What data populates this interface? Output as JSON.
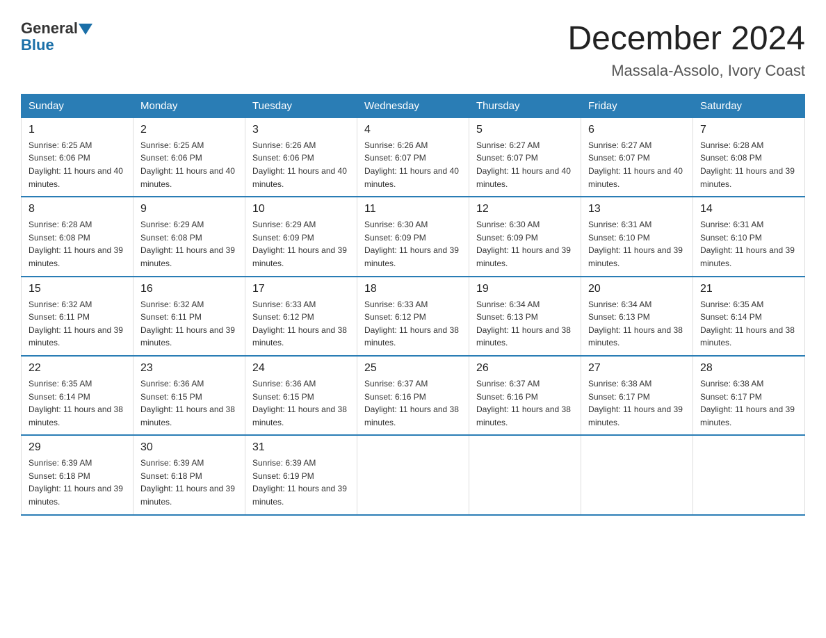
{
  "header": {
    "logo_general": "General",
    "logo_blue": "Blue",
    "month_title": "December 2024",
    "location": "Massala-Assolo, Ivory Coast"
  },
  "columns": [
    "Sunday",
    "Monday",
    "Tuesday",
    "Wednesday",
    "Thursday",
    "Friday",
    "Saturday"
  ],
  "weeks": [
    [
      {
        "day": "1",
        "sunrise": "6:25 AM",
        "sunset": "6:06 PM",
        "daylight": "11 hours and 40 minutes."
      },
      {
        "day": "2",
        "sunrise": "6:25 AM",
        "sunset": "6:06 PM",
        "daylight": "11 hours and 40 minutes."
      },
      {
        "day": "3",
        "sunrise": "6:26 AM",
        "sunset": "6:06 PM",
        "daylight": "11 hours and 40 minutes."
      },
      {
        "day": "4",
        "sunrise": "6:26 AM",
        "sunset": "6:07 PM",
        "daylight": "11 hours and 40 minutes."
      },
      {
        "day": "5",
        "sunrise": "6:27 AM",
        "sunset": "6:07 PM",
        "daylight": "11 hours and 40 minutes."
      },
      {
        "day": "6",
        "sunrise": "6:27 AM",
        "sunset": "6:07 PM",
        "daylight": "11 hours and 40 minutes."
      },
      {
        "day": "7",
        "sunrise": "6:28 AM",
        "sunset": "6:08 PM",
        "daylight": "11 hours and 39 minutes."
      }
    ],
    [
      {
        "day": "8",
        "sunrise": "6:28 AM",
        "sunset": "6:08 PM",
        "daylight": "11 hours and 39 minutes."
      },
      {
        "day": "9",
        "sunrise": "6:29 AM",
        "sunset": "6:08 PM",
        "daylight": "11 hours and 39 minutes."
      },
      {
        "day": "10",
        "sunrise": "6:29 AM",
        "sunset": "6:09 PM",
        "daylight": "11 hours and 39 minutes."
      },
      {
        "day": "11",
        "sunrise": "6:30 AM",
        "sunset": "6:09 PM",
        "daylight": "11 hours and 39 minutes."
      },
      {
        "day": "12",
        "sunrise": "6:30 AM",
        "sunset": "6:09 PM",
        "daylight": "11 hours and 39 minutes."
      },
      {
        "day": "13",
        "sunrise": "6:31 AM",
        "sunset": "6:10 PM",
        "daylight": "11 hours and 39 minutes."
      },
      {
        "day": "14",
        "sunrise": "6:31 AM",
        "sunset": "6:10 PM",
        "daylight": "11 hours and 39 minutes."
      }
    ],
    [
      {
        "day": "15",
        "sunrise": "6:32 AM",
        "sunset": "6:11 PM",
        "daylight": "11 hours and 39 minutes."
      },
      {
        "day": "16",
        "sunrise": "6:32 AM",
        "sunset": "6:11 PM",
        "daylight": "11 hours and 39 minutes."
      },
      {
        "day": "17",
        "sunrise": "6:33 AM",
        "sunset": "6:12 PM",
        "daylight": "11 hours and 38 minutes."
      },
      {
        "day": "18",
        "sunrise": "6:33 AM",
        "sunset": "6:12 PM",
        "daylight": "11 hours and 38 minutes."
      },
      {
        "day": "19",
        "sunrise": "6:34 AM",
        "sunset": "6:13 PM",
        "daylight": "11 hours and 38 minutes."
      },
      {
        "day": "20",
        "sunrise": "6:34 AM",
        "sunset": "6:13 PM",
        "daylight": "11 hours and 38 minutes."
      },
      {
        "day": "21",
        "sunrise": "6:35 AM",
        "sunset": "6:14 PM",
        "daylight": "11 hours and 38 minutes."
      }
    ],
    [
      {
        "day": "22",
        "sunrise": "6:35 AM",
        "sunset": "6:14 PM",
        "daylight": "11 hours and 38 minutes."
      },
      {
        "day": "23",
        "sunrise": "6:36 AM",
        "sunset": "6:15 PM",
        "daylight": "11 hours and 38 minutes."
      },
      {
        "day": "24",
        "sunrise": "6:36 AM",
        "sunset": "6:15 PM",
        "daylight": "11 hours and 38 minutes."
      },
      {
        "day": "25",
        "sunrise": "6:37 AM",
        "sunset": "6:16 PM",
        "daylight": "11 hours and 38 minutes."
      },
      {
        "day": "26",
        "sunrise": "6:37 AM",
        "sunset": "6:16 PM",
        "daylight": "11 hours and 38 minutes."
      },
      {
        "day": "27",
        "sunrise": "6:38 AM",
        "sunset": "6:17 PM",
        "daylight": "11 hours and 39 minutes."
      },
      {
        "day": "28",
        "sunrise": "6:38 AM",
        "sunset": "6:17 PM",
        "daylight": "11 hours and 39 minutes."
      }
    ],
    [
      {
        "day": "29",
        "sunrise": "6:39 AM",
        "sunset": "6:18 PM",
        "daylight": "11 hours and 39 minutes."
      },
      {
        "day": "30",
        "sunrise": "6:39 AM",
        "sunset": "6:18 PM",
        "daylight": "11 hours and 39 minutes."
      },
      {
        "day": "31",
        "sunrise": "6:39 AM",
        "sunset": "6:19 PM",
        "daylight": "11 hours and 39 minutes."
      },
      null,
      null,
      null,
      null
    ]
  ]
}
